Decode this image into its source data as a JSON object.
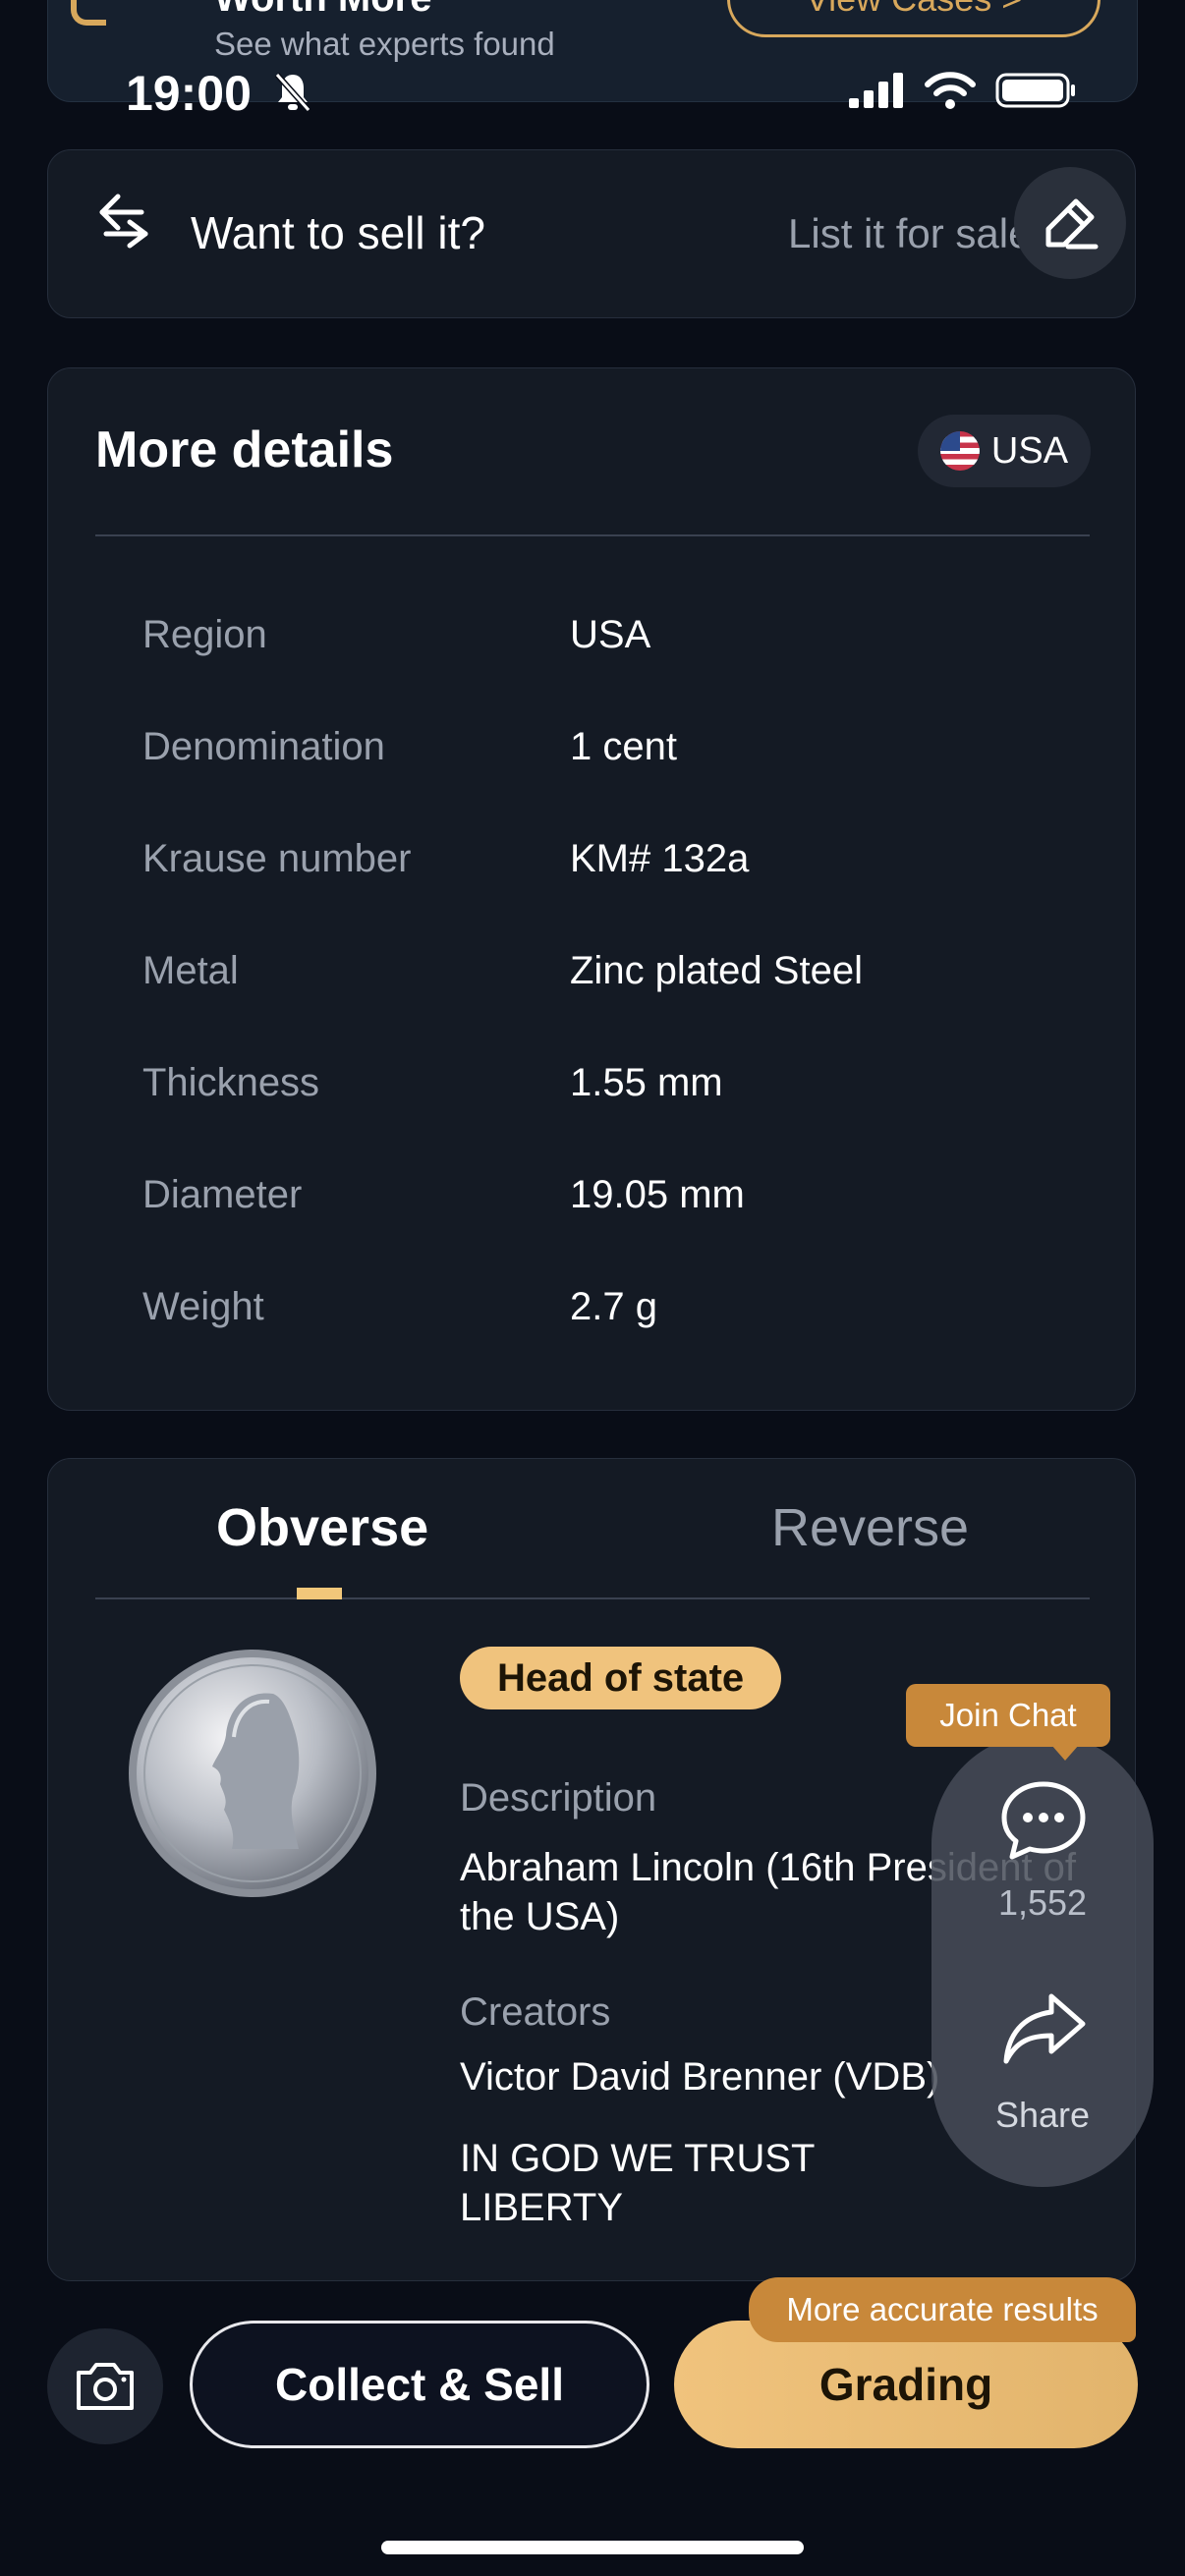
{
  "top_banner": {
    "title": "Worth More",
    "subtitle": "See what experts found",
    "button_label": "View Cases >"
  },
  "status_bar": {
    "time": "19:00"
  },
  "sell": {
    "title": "Want to sell it?",
    "link": "List it for sale >"
  },
  "details": {
    "title": "More details",
    "country": "USA",
    "rows": [
      {
        "label": "Region",
        "value": "USA"
      },
      {
        "label": "Denomination",
        "value": "1 cent"
      },
      {
        "label": "Krause number",
        "value": "KM# 132a"
      },
      {
        "label": "Metal",
        "value": "Zinc plated Steel"
      },
      {
        "label": "Thickness",
        "value": "1.55 mm"
      },
      {
        "label": "Diameter",
        "value": "19.05 mm"
      },
      {
        "label": "Weight",
        "value": "2.7 g"
      }
    ]
  },
  "coin": {
    "tabs": [
      "Obverse",
      "Reverse"
    ],
    "active_tab": "Obverse",
    "tag": "Head of state",
    "description_label": "Description",
    "description": "Abraham Lincoln (16th President of the USA)",
    "creators_label": "Creators",
    "creators": "Victor David Brenner (VDB)",
    "inscription_line1": "IN GOD WE TRUST",
    "inscription_line2": "LIBERTY"
  },
  "float_panel": {
    "join_chat": "Join Chat",
    "chat_count": "1,552",
    "share_label": "Share"
  },
  "bottom": {
    "collect_label": "Collect & Sell",
    "grading_label": "Grading",
    "accurate_tag": "More accurate results"
  },
  "colors": {
    "background": "#090d17",
    "card": "#141a24",
    "accent": "#f0c37d",
    "orange": "#c8883a"
  }
}
